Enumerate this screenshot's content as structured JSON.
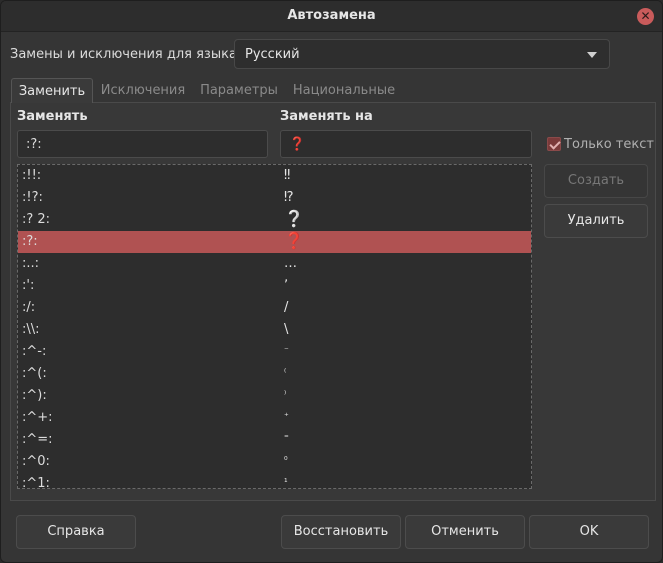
{
  "window": {
    "title": "Автозамена"
  },
  "language": {
    "label": "Замены и исключения для языка:",
    "selected": "Русский"
  },
  "tabs": [
    {
      "label": "Заменить",
      "active": true
    },
    {
      "label": "Исключения",
      "active": false
    },
    {
      "label": "Параметры",
      "active": false
    },
    {
      "label": "Национальные",
      "active": false
    }
  ],
  "replace": {
    "label_from": "Заменять",
    "label_to": "Заменять на",
    "from_value": ":?:",
    "to_value": "❓",
    "text_only_label": "Только текст",
    "text_only_checked": true
  },
  "rows": [
    {
      "from": ":!!:",
      "to": "‼"
    },
    {
      "from": ":!?:",
      "to": "⁉"
    },
    {
      "from": ":? 2:",
      "to": "❔"
    },
    {
      "from": ":?:",
      "to": "❓",
      "selected": true
    },
    {
      "from": ":..:",
      "to": "…"
    },
    {
      "from": ":':",
      "to": "ʼ"
    },
    {
      "from": ":/:",
      "to": "/"
    },
    {
      "from": ":\\\\:",
      "to": "\\"
    },
    {
      "from": ":^-:",
      "to": "⁻"
    },
    {
      "from": ":^(:",
      "to": "⁽"
    },
    {
      "from": ":^):",
      "to": "⁾"
    },
    {
      "from": ":^+:",
      "to": "⁺"
    },
    {
      "from": ":^=:",
      "to": "⁼"
    },
    {
      "from": ":^0:",
      "to": "⁰"
    },
    {
      "from": ":^1:",
      "to": "¹"
    }
  ],
  "side_buttons": {
    "create": "Создать",
    "delete": "Удалить"
  },
  "bottom_buttons": {
    "help": "Справка",
    "reset": "Восстановить",
    "cancel": "Отменить",
    "ok": "OK"
  }
}
